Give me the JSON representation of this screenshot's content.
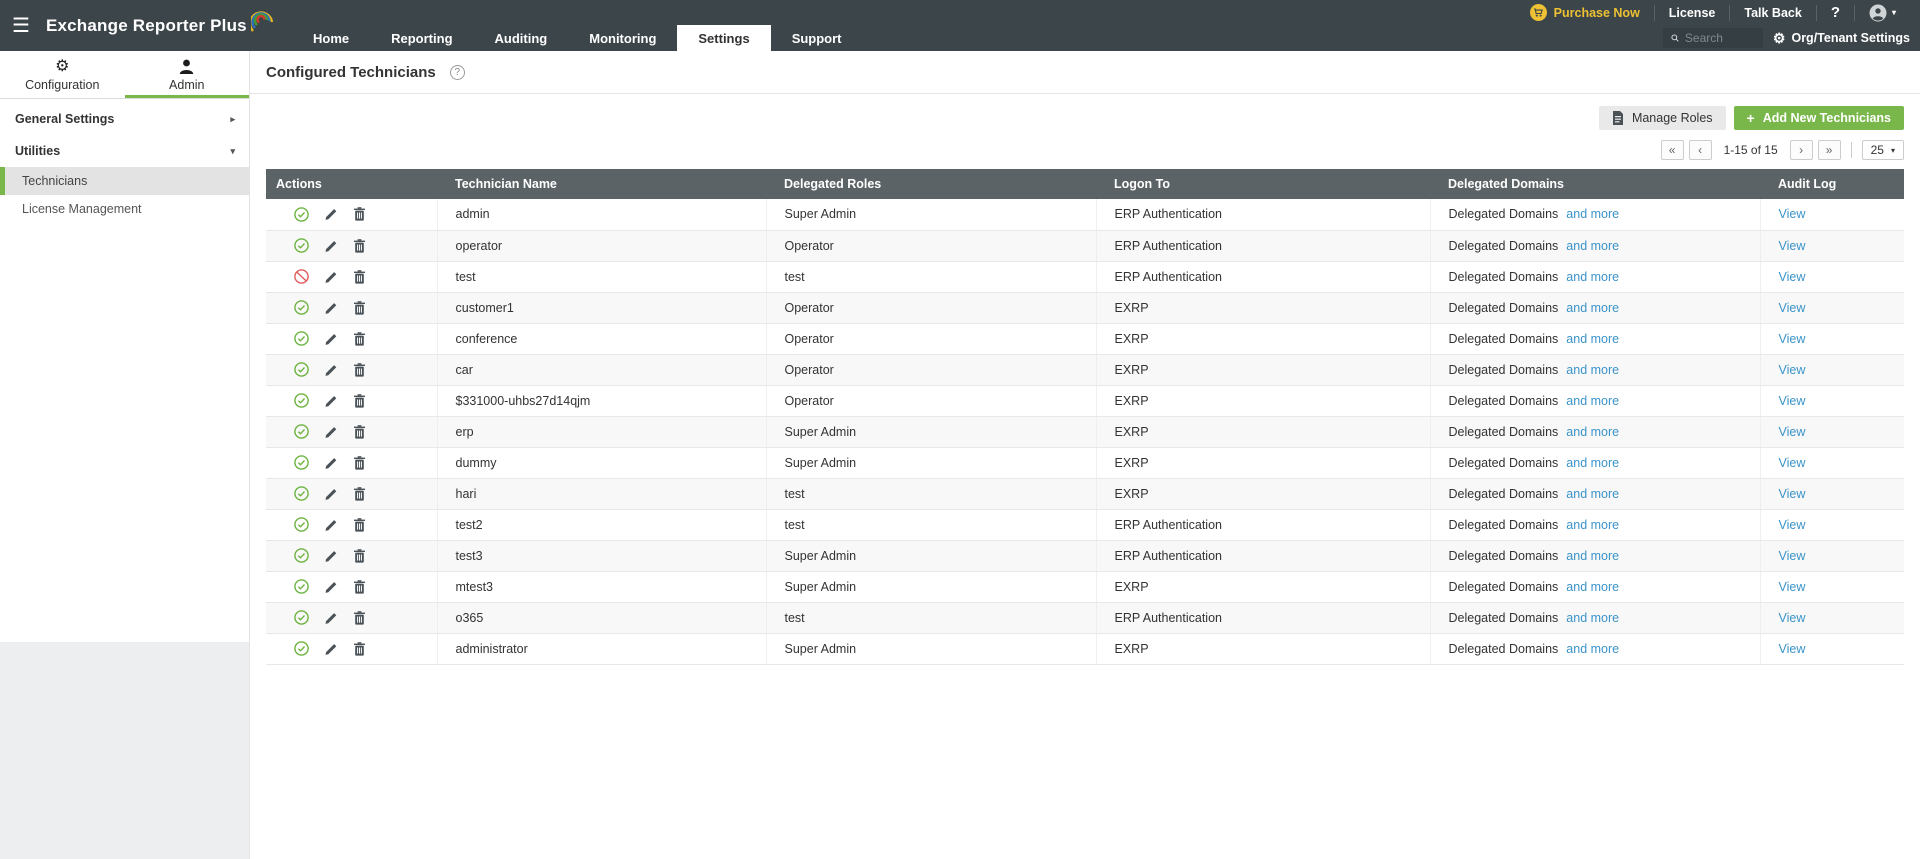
{
  "topbar": {
    "brand": "Exchange Reporter Plus",
    "purchase_label": "Purchase Now",
    "license_label": "License",
    "talkback_label": "Talk Back",
    "help_label": "?",
    "nav": [
      {
        "label": "Home",
        "active": false
      },
      {
        "label": "Reporting",
        "active": false
      },
      {
        "label": "Auditing",
        "active": false
      },
      {
        "label": "Monitoring",
        "active": false
      },
      {
        "label": "Settings",
        "active": true
      },
      {
        "label": "Support",
        "active": false
      }
    ],
    "search_placeholder": "Search",
    "org_settings_label": "Org/Tenant Settings"
  },
  "sidebar": {
    "tabs": [
      {
        "label": "Configuration",
        "active": false
      },
      {
        "label": "Admin",
        "active": true
      }
    ],
    "sections": [
      {
        "label": "General Settings",
        "arrow": "▸"
      },
      {
        "label": "Utilities",
        "arrow": "▾"
      }
    ],
    "items": [
      {
        "label": "Technicians",
        "selected": true
      },
      {
        "label": "License Management",
        "selected": false
      }
    ]
  },
  "page": {
    "title": "Configured Technicians",
    "help_glyph": "?"
  },
  "toolbar": {
    "manage_roles_label": "Manage Roles",
    "add_new_label": "Add New Technicians",
    "plus_glyph": "+"
  },
  "pagination": {
    "first": "«",
    "prev": "‹",
    "range": "1-15 of 15",
    "next": "›",
    "last": "»",
    "page_size": "25",
    "caret": "▾"
  },
  "table": {
    "columns": [
      "Actions",
      "Technician Name",
      "Delegated Roles",
      "Logon To",
      "Delegated Domains",
      "Audit Log"
    ],
    "delegated_domains_label": "Delegated Domains",
    "and_more_label": "and more",
    "view_label": "View",
    "rows": [
      {
        "name": "admin",
        "role": "Super Admin",
        "logon": "ERP Authentication",
        "status": "enabled"
      },
      {
        "name": "operator",
        "role": "Operator",
        "logon": "ERP Authentication",
        "status": "enabled"
      },
      {
        "name": "test",
        "role": "test",
        "logon": "ERP Authentication",
        "status": "disabled"
      },
      {
        "name": "customer1",
        "role": "Operator",
        "logon": "EXRP",
        "status": "enabled"
      },
      {
        "name": "conference",
        "role": "Operator",
        "logon": "EXRP",
        "status": "enabled"
      },
      {
        "name": "car",
        "role": "Operator",
        "logon": "EXRP",
        "status": "enabled"
      },
      {
        "name": "$331000-uhbs27d14qjm",
        "role": "Operator",
        "logon": "EXRP",
        "status": "enabled"
      },
      {
        "name": "erp",
        "role": "Super Admin",
        "logon": "EXRP",
        "status": "enabled"
      },
      {
        "name": "dummy",
        "role": "Super Admin",
        "logon": "EXRP",
        "status": "enabled"
      },
      {
        "name": "hari",
        "role": "test",
        "logon": "EXRP",
        "status": "enabled"
      },
      {
        "name": "test2",
        "role": "test",
        "logon": "ERP Authentication",
        "status": "enabled"
      },
      {
        "name": "test3",
        "role": "Super Admin",
        "logon": "ERP Authentication",
        "status": "enabled"
      },
      {
        "name": "mtest3",
        "role": "Super Admin",
        "logon": "EXRP",
        "status": "enabled"
      },
      {
        "name": "o365",
        "role": "test",
        "logon": "ERP Authentication",
        "status": "enabled"
      },
      {
        "name": "administrator",
        "role": "Super Admin",
        "logon": "EXRP",
        "status": "enabled"
      }
    ]
  },
  "colors": {
    "topbar_bg": "#3c4549",
    "accent_green": "#79b74b",
    "link_blue": "#3a93c9",
    "purchase_gold": "#edc133",
    "table_header_bg": "#5b6367",
    "status_green": "#6cb33f",
    "status_red": "#e05c5c"
  }
}
